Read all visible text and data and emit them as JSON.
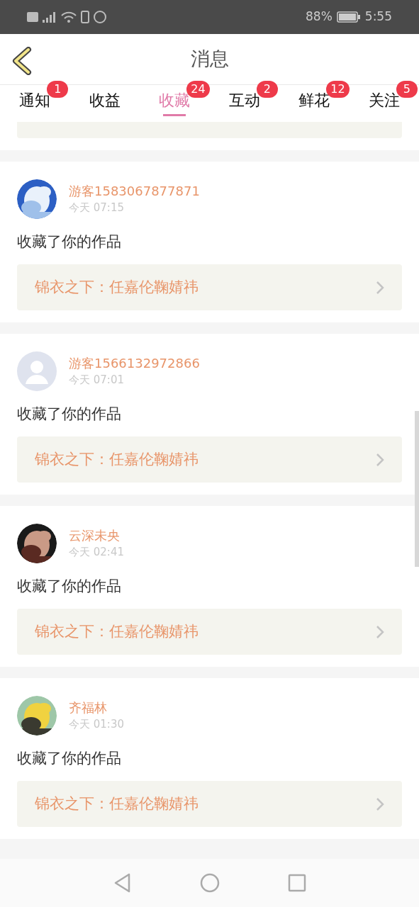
{
  "status_bar": {
    "battery": "88%",
    "time": "5:55"
  },
  "header": {
    "title": "消息"
  },
  "tabs": [
    {
      "label": "通知",
      "badge": "1",
      "selected": false
    },
    {
      "label": "收益",
      "selected": false
    },
    {
      "label": "收藏",
      "badge": "24",
      "selected": true
    },
    {
      "label": "互动",
      "badge": "2",
      "selected": false
    },
    {
      "label": "鲜花",
      "badge": "12",
      "selected": false
    },
    {
      "label": "关注",
      "badge": "5",
      "selected": false
    }
  ],
  "items": [
    {
      "kind": "picture",
      "user": "游客1583067877871",
      "time": "今天 07:15",
      "action": "收藏了你的作品",
      "work": "锦衣之下：任嘉伦鞠婧祎"
    },
    {
      "kind": "default",
      "user": "游客1566132972866",
      "time": "今天 07:01",
      "action": "收藏了你的作品",
      "work": "锦衣之下：任嘉伦鞠婧祎"
    },
    {
      "kind": "picture",
      "user": "云深未央",
      "time": "今天 02:41",
      "action": "收藏了你的作品",
      "work": "锦衣之下：任嘉伦鞠婧祎"
    },
    {
      "kind": "picture",
      "user": "齐福林",
      "time": "今天 01:30",
      "action": "收藏了你的作品",
      "work": "锦衣之下：任嘉伦鞠婧祎"
    }
  ]
}
